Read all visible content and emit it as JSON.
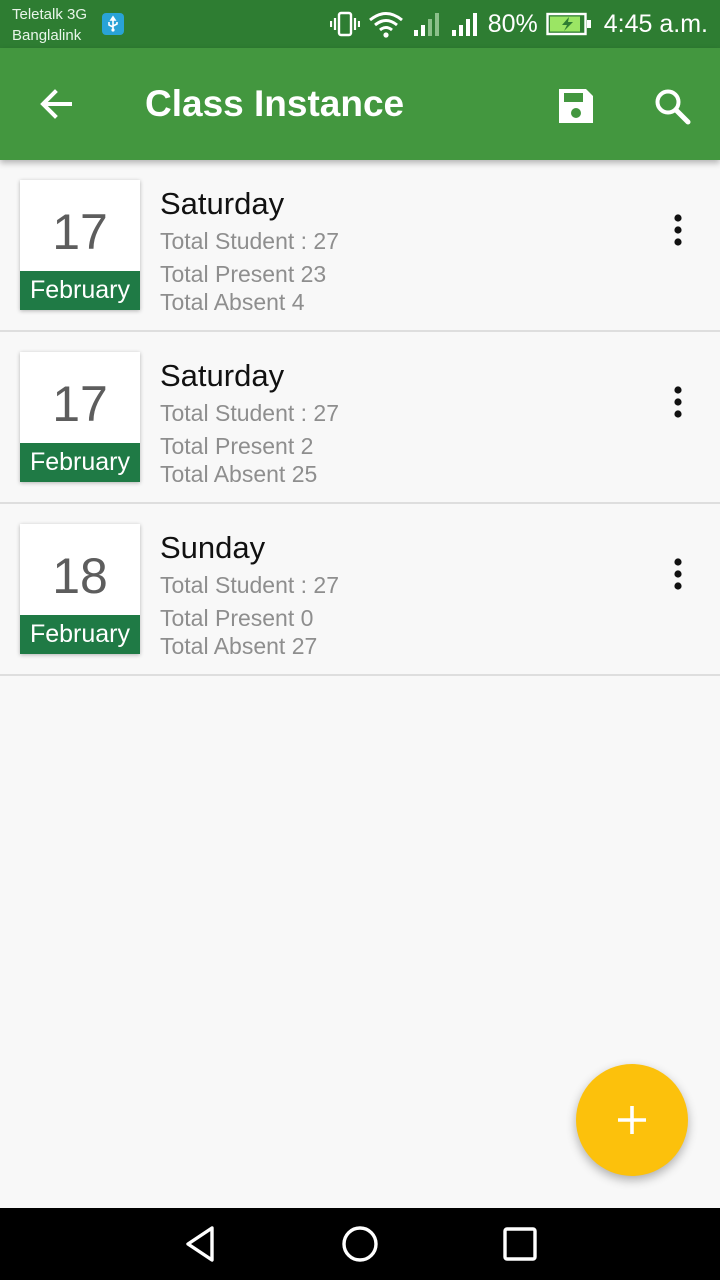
{
  "status_bar": {
    "carrier_1": "Teletalk 3G",
    "carrier_2": "Banglalink",
    "battery": "80%",
    "time": "4:45 a.m.",
    "icons": [
      "usb-icon",
      "vibrate-icon",
      "wifi-icon",
      "signal-icon",
      "signal-icon",
      "battery-charging-icon"
    ]
  },
  "app_bar": {
    "title": "Class Instance",
    "background": "#43973f",
    "icons": [
      "back-arrow-icon",
      "save-icon",
      "search-icon"
    ]
  },
  "list": [
    {
      "day": "17",
      "month": "February",
      "weekday": "Saturday",
      "total_student": "Total Student : 27",
      "present": "Total Present 23",
      "absent": "Total Absent 4"
    },
    {
      "day": "17",
      "month": "February",
      "weekday": "Saturday",
      "total_student": "Total Student : 27",
      "present": "Total Present 2",
      "absent": "Total Absent 25"
    },
    {
      "day": "18",
      "month": "February",
      "weekday": "Sunday",
      "total_student": "Total Student : 27",
      "present": "Total Present 0",
      "absent": "Total Absent 27"
    }
  ],
  "colors": {
    "status_bar": "#2e7d32",
    "month_band": "#1f7a45",
    "fab": "#fcc10c"
  },
  "fab": {
    "icon": "plus-icon"
  },
  "nav_bar": {
    "icons": [
      "nav-back-icon",
      "nav-home-icon",
      "nav-recents-icon"
    ]
  }
}
